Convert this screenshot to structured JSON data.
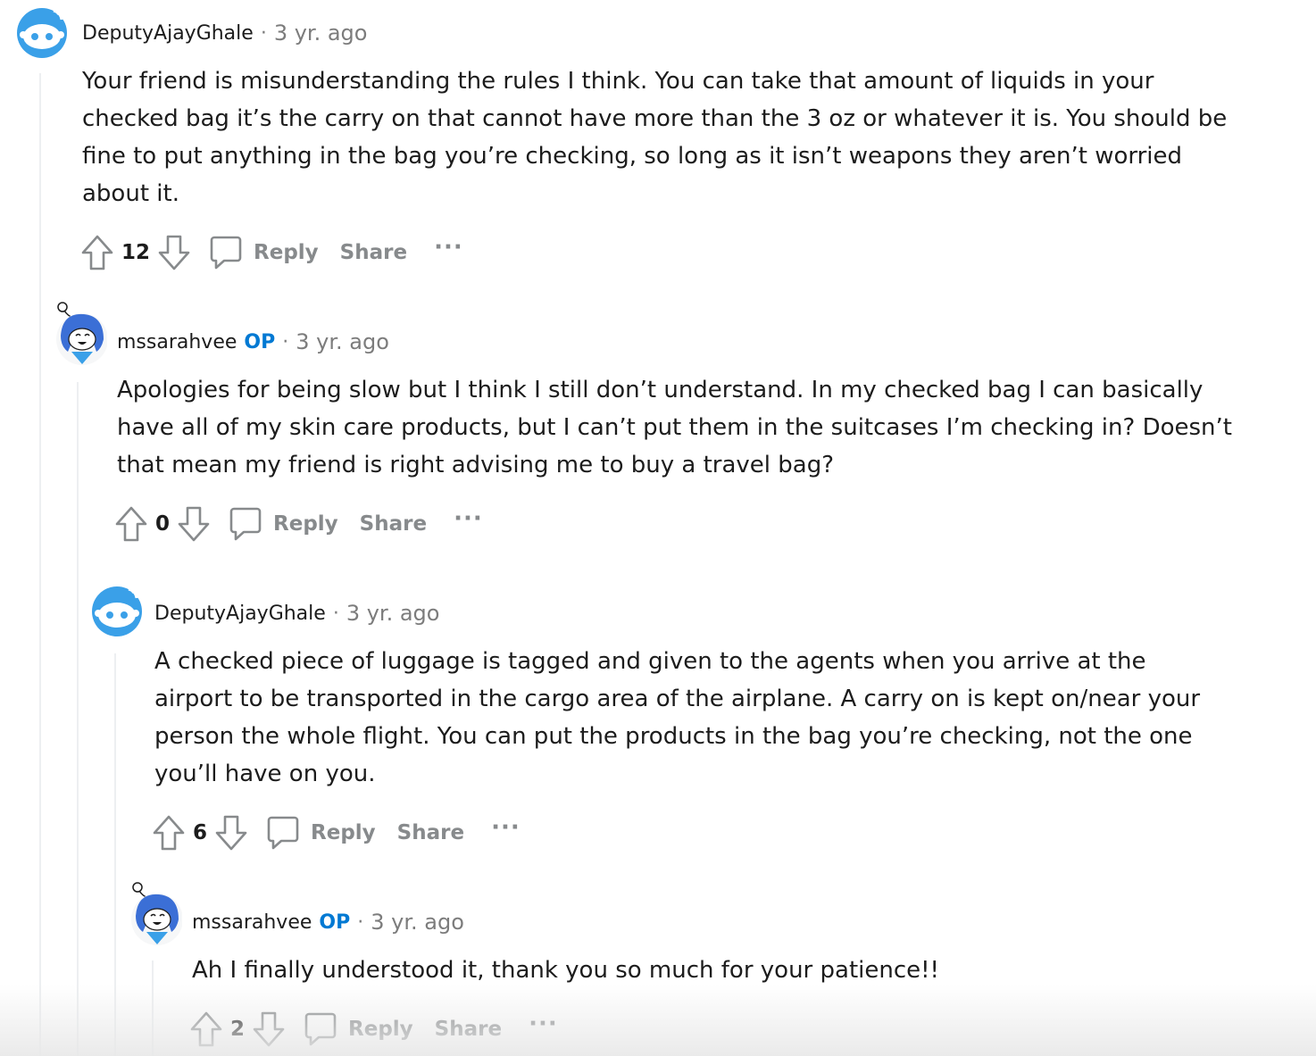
{
  "comments": [
    {
      "username": "DeputyAjayGhale",
      "op": "",
      "separator": "·",
      "time": "3 yr. ago",
      "avatar": "snoo-default-avatar",
      "lines": [
        "Your friend is misunderstanding the rules I think. You can take that amount of liquids in your",
        "checked bag it’s the carry on that cannot have more than the 3 oz or whatever it is. You should be",
        "fine to put anything in the bag you’re checking, so long as it isn’t weapons they aren’t worried",
        "about it."
      ],
      "score": "12",
      "reply": "Reply",
      "share": "Share",
      "more": "···"
    },
    {
      "username": "mssarahvee",
      "op": "OP",
      "separator": "·",
      "time": "3 yr. ago",
      "avatar": "snoo-girl-avatar",
      "lines": [
        "Apologies for being slow but I think I still don’t understand. In my checked bag I can basically",
        "have all of my skin care products, but I can’t put them in the suitcases I’m checking in? Doesn’t",
        "that mean my friend is right advising me to buy a travel bag?"
      ],
      "score": "0",
      "reply": "Reply",
      "share": "Share",
      "more": "···"
    },
    {
      "username": "DeputyAjayGhale",
      "op": "",
      "separator": "·",
      "time": "3 yr. ago",
      "avatar": "snoo-default-avatar",
      "lines": [
        "A checked piece of luggage is tagged and given to the agents when you arrive at the",
        "airport to be transported in the cargo area of the airplane. A carry on is kept on/near your",
        "person the whole flight. You can put the products in the bag you’re checking, not the one",
        "you’ll have on you."
      ],
      "score": "6",
      "reply": "Reply",
      "share": "Share",
      "more": "···"
    },
    {
      "username": "mssarahvee",
      "op": "OP",
      "separator": "·",
      "time": "3 yr. ago",
      "avatar": "snoo-girl-avatar",
      "lines": [
        "Ah I finally understood it, thank you so much for your patience!!"
      ],
      "score": "2",
      "reply": "Reply",
      "share": "Share",
      "more": "···"
    }
  ],
  "colors": {
    "op_badge": "#0079d3",
    "meta_gray": "#7c7c7c",
    "action_gray": "#878a8c",
    "avatar_blue": "#0dd3bb",
    "thread_line": "#edeff1"
  },
  "icons": [
    "upvote-icon",
    "downvote-icon",
    "comment-bubble-icon",
    "more-options-icon"
  ]
}
